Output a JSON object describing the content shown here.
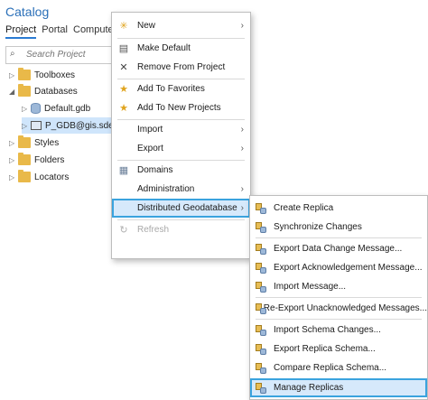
{
  "pane": {
    "title": "Catalog",
    "tabs": [
      {
        "label": "Project",
        "active": true
      },
      {
        "label": "Portal",
        "active": false
      },
      {
        "label": "Compute",
        "active": false
      }
    ],
    "search_placeholder": "Search Project"
  },
  "tree": [
    {
      "label": "Toolboxes",
      "icon": "toolbox-folder-icon",
      "level": 1,
      "expanded": false
    },
    {
      "label": "Databases",
      "icon": "databases-folder-icon",
      "level": 1,
      "expanded": true
    },
    {
      "label": "Default.gdb",
      "icon": "geodatabase-icon",
      "level": 2,
      "expanded": false
    },
    {
      "label": "P_GDB@gis.sde",
      "icon": "sde-connection-icon",
      "level": 2,
      "expanded": false,
      "selected": true
    },
    {
      "label": "Styles",
      "icon": "styles-folder-icon",
      "level": 1,
      "expanded": false
    },
    {
      "label": "Folders",
      "icon": "folders-folder-icon",
      "level": 1,
      "expanded": false
    },
    {
      "label": "Locators",
      "icon": "locators-folder-icon",
      "level": 1,
      "expanded": false
    }
  ],
  "context_menu": {
    "items": [
      {
        "label": "New",
        "icon": "new-icon",
        "submenu": true
      },
      {
        "label": "Make Default",
        "icon": "make-default-icon",
        "submenu": false
      },
      {
        "label": "Remove From Project",
        "icon": "remove-icon",
        "submenu": false
      },
      {
        "label": "Add To Favorites",
        "icon": "favorite-star-icon",
        "submenu": false
      },
      {
        "label": "Add To New Projects",
        "icon": "favorite-new-projects-icon",
        "submenu": false
      },
      {
        "label": "Import",
        "icon": "",
        "submenu": true
      },
      {
        "label": "Export",
        "icon": "",
        "submenu": true
      },
      {
        "label": "Domains",
        "icon": "domains-icon",
        "submenu": false
      },
      {
        "label": "Administration",
        "icon": "",
        "submenu": true
      },
      {
        "label": "Distributed Geodatabase",
        "icon": "",
        "submenu": true,
        "highlighted": true
      },
      {
        "label": "Refresh",
        "icon": "refresh-icon",
        "submenu": false,
        "disabled": true
      }
    ]
  },
  "submenu": {
    "items": [
      {
        "label": "Create Replica",
        "icon": "create-replica-icon"
      },
      {
        "label": "Synchronize Changes",
        "icon": "synchronize-changes-icon"
      },
      {
        "label": "Export Data Change Message...",
        "icon": "export-data-change-icon"
      },
      {
        "label": "Export Acknowledgement Message...",
        "icon": "export-acknowledgement-icon"
      },
      {
        "label": "Import Message...",
        "icon": "import-message-icon"
      },
      {
        "label": "Re-Export Unacknowledged Messages...",
        "icon": "re-export-messages-icon"
      },
      {
        "label": "Import Schema Changes...",
        "icon": "import-schema-icon"
      },
      {
        "label": "Export Replica Schema...",
        "icon": "export-schema-icon"
      },
      {
        "label": "Compare Replica Schema...",
        "icon": "compare-schema-icon"
      },
      {
        "label": "Manage Replicas",
        "icon": "manage-replicas-icon",
        "highlighted": true
      }
    ]
  },
  "colors": {
    "title": "#2a6fb8",
    "highlight_border": "#3aa3de",
    "highlight_fill": "#d6e9fb",
    "selection": "#cfe5fb"
  }
}
